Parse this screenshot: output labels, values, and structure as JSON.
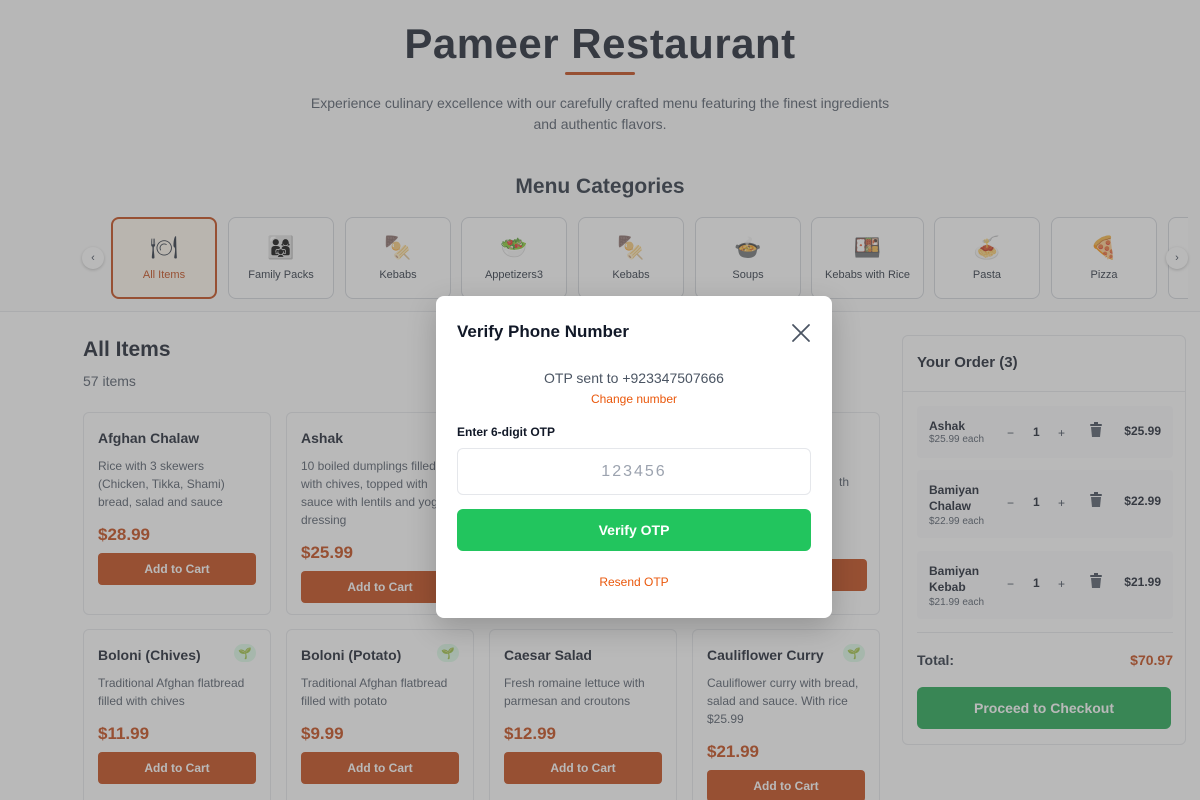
{
  "header": {
    "title": "Pameer Restaurant",
    "subtitle": "Experience culinary excellence with our carefully crafted menu featuring the finest ingredients and authentic flavors.",
    "categories_heading": "Menu Categories"
  },
  "categories": {
    "prev_label": "‹",
    "next_label": "›",
    "items": [
      {
        "label": "All Items",
        "icon": "🍽"
      },
      {
        "label": "Family Packs",
        "icon": "👨‍👩‍👧"
      },
      {
        "label": "Kebabs",
        "icon": "🍢"
      },
      {
        "label": "Appetizers3",
        "icon": "🥗"
      },
      {
        "label": "Kebabs",
        "icon": "🍢"
      },
      {
        "label": "Soups",
        "icon": "🍲"
      },
      {
        "label": "Kebabs with Rice",
        "icon": "🍱"
      },
      {
        "label": "Pasta",
        "icon": "🍝"
      },
      {
        "label": "Pizza",
        "icon": "🍕"
      }
    ]
  },
  "menu": {
    "title": "All Items",
    "count": "57 items",
    "add_label": "Add to Cart",
    "veg_icon": "🌱",
    "items": [
      {
        "name": "Afghan Chalaw",
        "desc": "Rice with 3 skewers (Chicken, Tikka, Shami) bread, salad and sauce",
        "price": "$28.99"
      },
      {
        "name": "Ashak",
        "desc": "10 boiled dumplings filled with chives, topped with sauce with lentils and yogurt dressing",
        "price": "$25.99"
      },
      {
        "name": "",
        "desc": "",
        "price": ""
      },
      {
        "name": "",
        "desc": "th",
        "price": ""
      },
      {
        "name": "Boloni (Chives)",
        "desc": "Traditional Afghan flatbread filled with chives",
        "price": "$11.99"
      },
      {
        "name": "Boloni (Potato)",
        "desc": "Traditional Afghan flatbread filled with potato",
        "price": "$9.99"
      },
      {
        "name": "Caesar Salad",
        "desc": "Fresh romaine lettuce with parmesan and croutons",
        "price": "$12.99"
      },
      {
        "name": "Cauliflower Curry",
        "desc": "Cauliflower curry with bread, salad and sauce. With rice $25.99",
        "price": "$21.99"
      }
    ]
  },
  "order": {
    "title": "Your Order (3)",
    "minus": "−",
    "plus": "+",
    "items": [
      {
        "name": "Ashak",
        "each": "$25.99 each",
        "qty": "1",
        "total": "$25.99"
      },
      {
        "name": "Bamiyan Chalaw",
        "each": "$22.99 each",
        "qty": "1",
        "total": "$22.99"
      },
      {
        "name": "Bamiyan Kebab",
        "each": "$21.99 each",
        "qty": "1",
        "total": "$21.99"
      }
    ],
    "total_label": "Total:",
    "total_value": "$70.97",
    "checkout_label": "Proceed to Checkout"
  },
  "modal": {
    "title": "Verify Phone Number",
    "sent_text": "OTP sent to +923347507666",
    "change_label": "Change number",
    "otp_label": "Enter 6-digit OTP",
    "otp_placeholder": "123456",
    "verify_label": "Verify OTP",
    "resend_label": "Resend OTP"
  },
  "colors": {
    "accent": "#c2410c",
    "success": "#22c55e",
    "checkout": "#16a34a"
  }
}
